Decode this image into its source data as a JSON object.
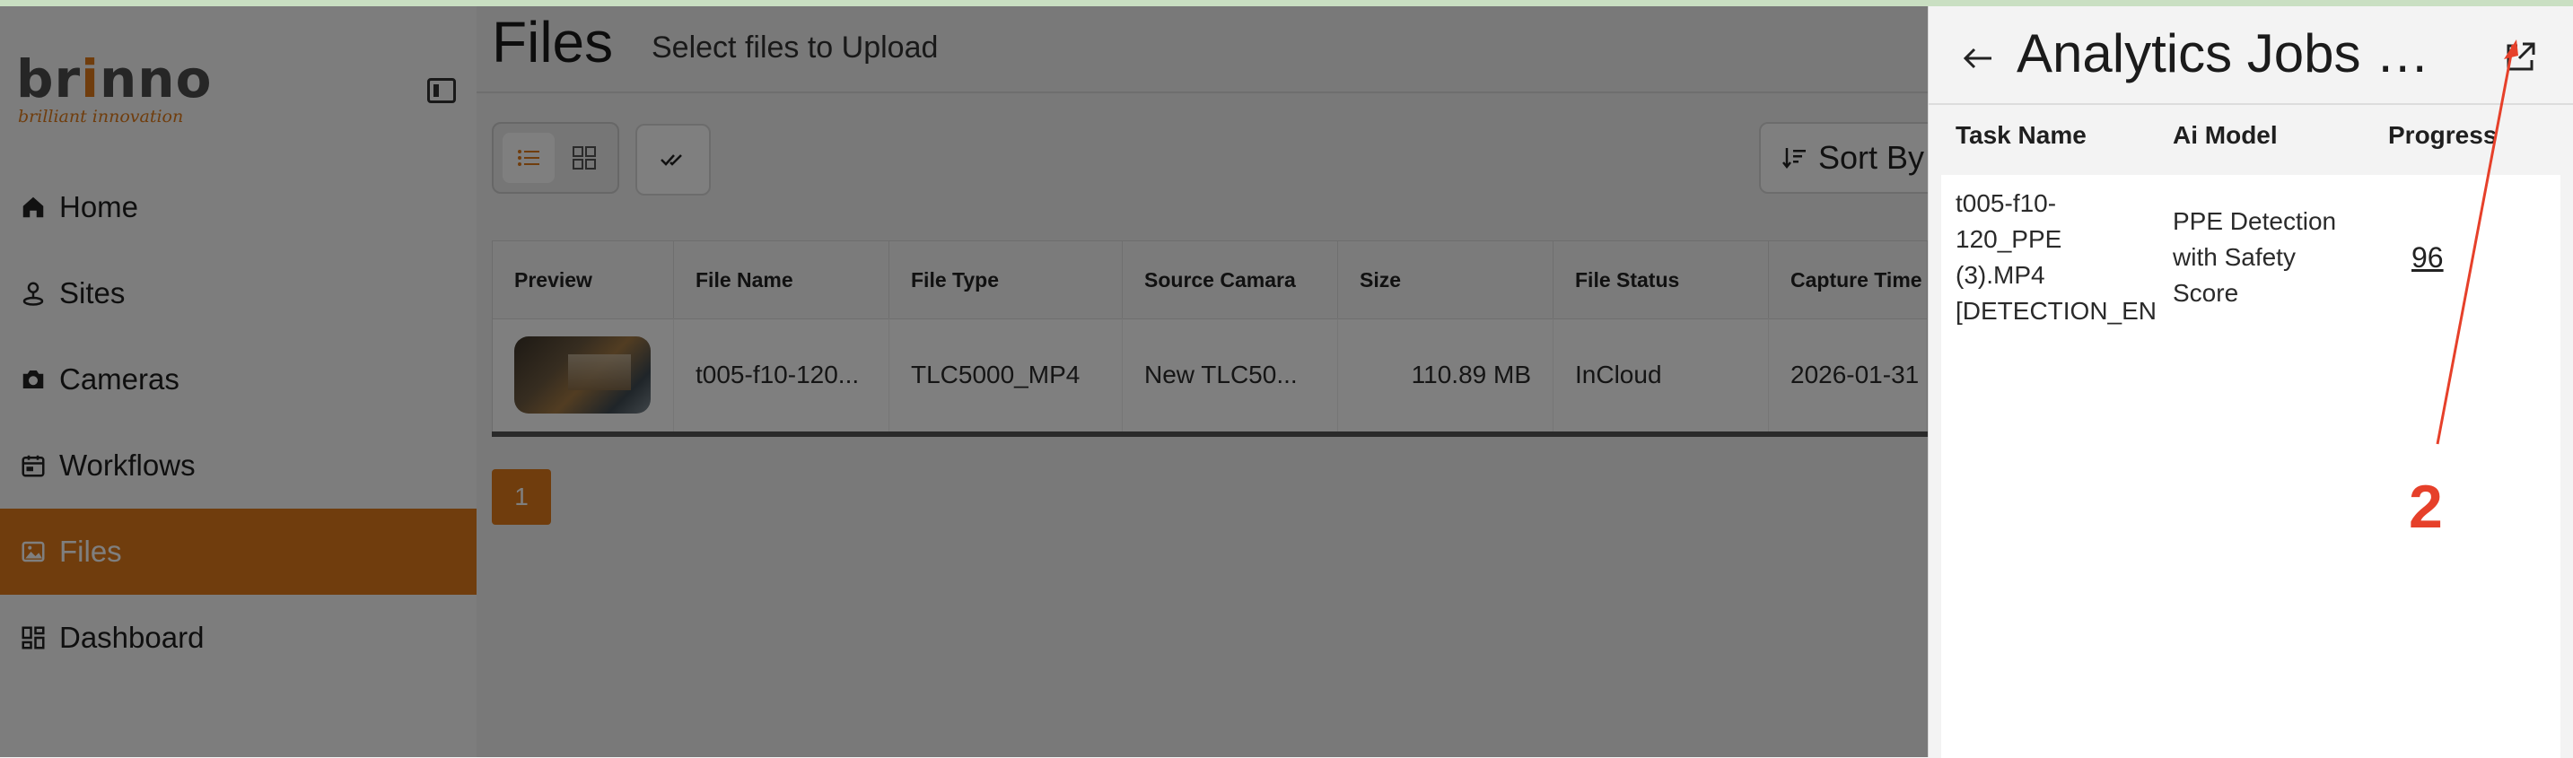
{
  "brand": {
    "name": "brinno",
    "tagline": "brilliant innovation",
    "accent": "#e07b1a"
  },
  "sidebar": {
    "items": [
      {
        "label": "Home",
        "icon": "home-icon",
        "active": false
      },
      {
        "label": "Sites",
        "icon": "person-pin-icon",
        "active": false
      },
      {
        "label": "Cameras",
        "icon": "camera-icon",
        "active": false
      },
      {
        "label": "Workflows",
        "icon": "calendar-workflow-icon",
        "active": false
      },
      {
        "label": "Files",
        "icon": "image-icon",
        "active": true
      },
      {
        "label": "Dashboard",
        "icon": "dashboard-grid-icon",
        "active": false
      }
    ]
  },
  "page": {
    "title": "Files",
    "subtitle": "Select files to Upload"
  },
  "toolbar": {
    "sort_label": "Sort By"
  },
  "table": {
    "columns": [
      "Preview",
      "File Name",
      "File Type",
      "Source Camara",
      "Size",
      "File Status",
      "Capture Time"
    ],
    "rows": [
      {
        "file_name": "t005-f10-120...",
        "file_type": "TLC5000_MP4",
        "source_camera": "New TLC50...",
        "size": "110.89 MB",
        "file_status": "InCloud",
        "capture_time": "2026-01-31"
      }
    ]
  },
  "pagination": {
    "current": "1"
  },
  "drawer": {
    "title": "Analytics Jobs Hi...",
    "columns": [
      "Task Name",
      "Ai Model",
      "Progress"
    ],
    "rows": [
      {
        "task_name": "t005-f10-\n120_PPE\n(3).MP4\n[DETECTION_EN",
        "ai_model": "PPE Detection\nwith Safety\nScore",
        "progress": "96"
      }
    ]
  },
  "annotation": {
    "label": "2",
    "color": "#e6402a"
  }
}
